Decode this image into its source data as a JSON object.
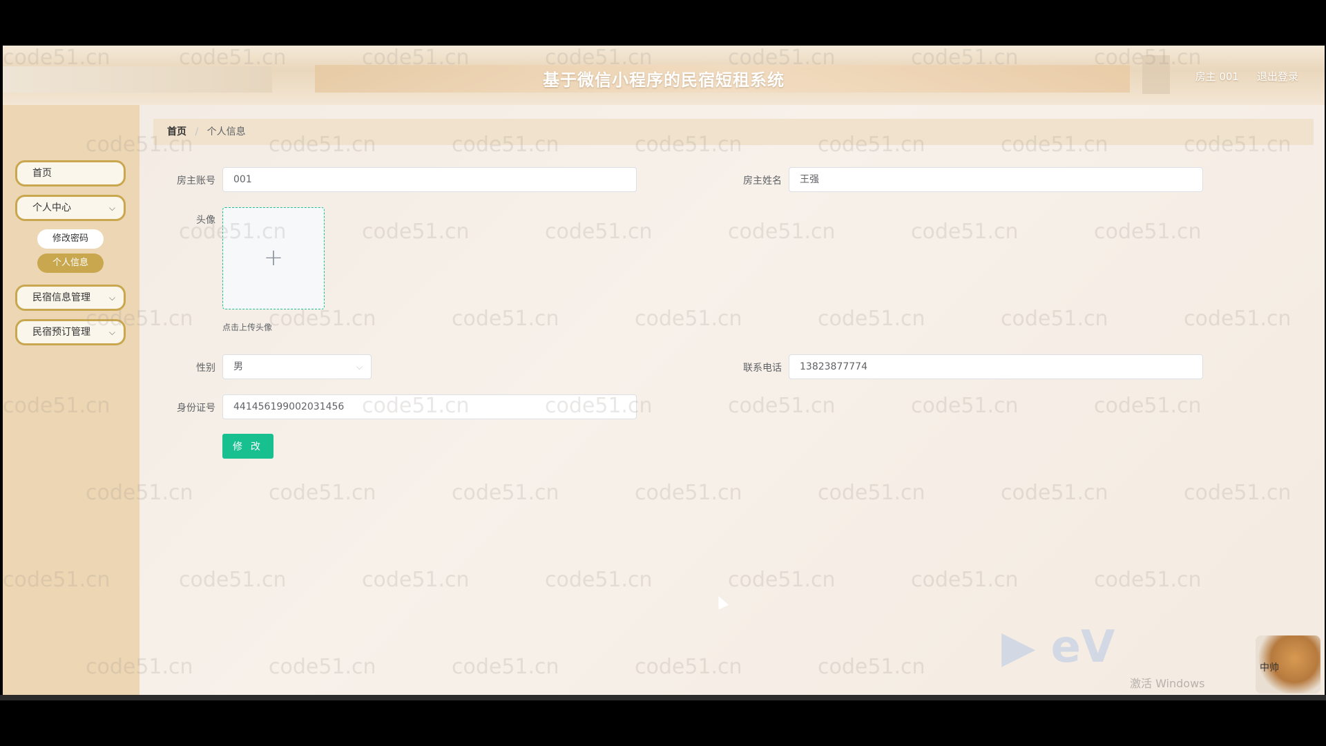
{
  "header": {
    "title": "基于微信小程序的民宿短租系统",
    "user": "房主 001",
    "logout": "退出登录"
  },
  "sidebar": {
    "home": "首页",
    "personal_center": "个人中心",
    "change_password": "修改密码",
    "personal_info": "个人信息",
    "homestay_info_mgmt": "民宿信息管理",
    "homestay_booking_mgmt": "民宿预订管理"
  },
  "breadcrumb": {
    "home": "首页",
    "separator": "/",
    "current": "个人信息"
  },
  "form": {
    "owner_account_label": "房主账号",
    "owner_account_value": "001",
    "owner_name_label": "房主姓名",
    "owner_name_value": "王强",
    "avatar_label": "头像",
    "avatar_tip": "点击上传头像",
    "gender_label": "性别",
    "gender_value": "男",
    "phone_label": "联系电话",
    "phone_value": "13823877774",
    "id_label": "身份证号",
    "id_value": "441456199002031456",
    "submit_label": "修 改"
  },
  "watermark": {
    "text": "code51.cn",
    "windows_text": "激活 Windows",
    "badge_text": "中帅"
  },
  "icons": {
    "chevron": "chevron-down-icon",
    "plus": "plus-icon"
  },
  "colors": {
    "accent_gold": "#c9a74f",
    "submit_green": "#18c08f",
    "sidebar_bg": "#ecd6b4",
    "breadcrumb_bg": "#f0e2cc"
  }
}
